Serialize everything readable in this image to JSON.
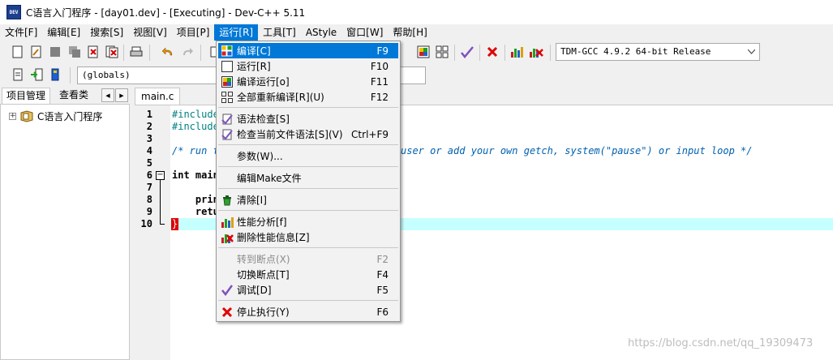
{
  "window": {
    "title": "C语言入门程序 - [day01.dev] - [Executing] - Dev-C++ 5.11",
    "app_icon_text": "DEV"
  },
  "menubar": [
    {
      "label": "文件[F]"
    },
    {
      "label": "编辑[E]"
    },
    {
      "label": "搜索[S]"
    },
    {
      "label": "视图[V]"
    },
    {
      "label": "项目[P]"
    },
    {
      "label": "运行[R]"
    },
    {
      "label": "工具[T]"
    },
    {
      "label": "AStyle"
    },
    {
      "label": "窗口[W]"
    },
    {
      "label": "帮助[H]"
    }
  ],
  "toolbar": {
    "compiler_select": "TDM-GCC 4.9.2 64-bit Release",
    "scope_select": "(globals)"
  },
  "left_panel": {
    "tabs": [
      "项目管理",
      "查看类"
    ],
    "tree": [
      {
        "label": "C语言入门程序",
        "expander": "+"
      }
    ]
  },
  "editor": {
    "tab_label": "main.c",
    "line_numbers": [
      "1",
      "2",
      "3",
      "4",
      "5",
      "6",
      "7",
      "8",
      "9",
      "10"
    ],
    "lines": [
      "#include",
      "#include",
      "",
      "/* run t",
      "",
      "int main",
      "",
      "    prin",
      "    retu",
      ""
    ],
    "comment_tail": "user or add your own getch, system(\"pause\") or input loop */",
    "brace": "}"
  },
  "run_menu": {
    "items": [
      {
        "label": "编译[C]",
        "shortcut": "F9",
        "icon": "compile-icon"
      },
      {
        "label": "运行[R]",
        "shortcut": "F10",
        "icon": "run-icon"
      },
      {
        "label": "编译运行[o]",
        "shortcut": "F11",
        "icon": "compile-run-icon"
      },
      {
        "label": "全部重新编译[R](U)",
        "shortcut": "F12",
        "icon": "rebuild-all-icon"
      },
      {
        "label": "语法检查[S]",
        "shortcut": "",
        "icon": "syntax-check-icon"
      },
      {
        "label": "检查当前文件语法[S](V)",
        "shortcut": "Ctrl+F9",
        "icon": "syntax-check-file-icon"
      },
      {
        "label": "参数(W)...",
        "shortcut": "",
        "icon": ""
      },
      {
        "label": "编辑Make文件",
        "shortcut": "",
        "icon": ""
      },
      {
        "label": "清除[I]",
        "shortcut": "",
        "icon": "clean-icon"
      },
      {
        "label": "性能分析[f]",
        "shortcut": "",
        "icon": "profile-icon"
      },
      {
        "label": "删除性能信息[Z]",
        "shortcut": "",
        "icon": "delete-profile-icon"
      },
      {
        "label": "转到断点(X)",
        "shortcut": "F2",
        "icon": "",
        "disabled": true
      },
      {
        "label": "切换断点[T]",
        "shortcut": "F4",
        "icon": ""
      },
      {
        "label": "调试[D]",
        "shortcut": "F5",
        "icon": "debug-check-icon"
      },
      {
        "label": "停止执行(Y)",
        "shortcut": "F6",
        "icon": "stop-icon"
      }
    ]
  },
  "watermark": "https://blog.csdn.net/qq_19309473",
  "colors": {
    "menu_highlight": "#0078d7",
    "current_line": "#c6ffff",
    "preprocessor": "#008080",
    "comment": "#0060b0"
  }
}
